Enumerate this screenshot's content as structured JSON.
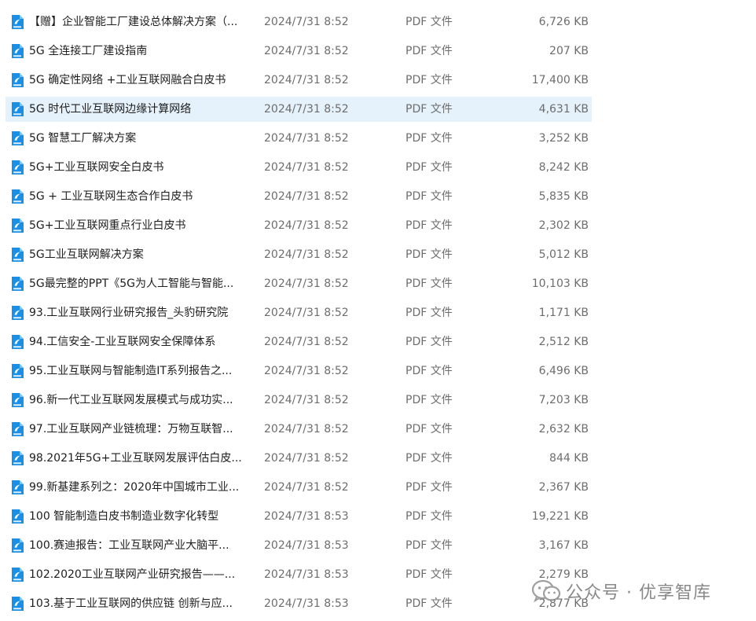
{
  "colors": {
    "selected_row_bg": "#e5f1fb",
    "pdf_icon_blue": "#1a8fe6",
    "name_text": "#1e1e1e",
    "meta_text": "#6d6d6d"
  },
  "icon_name": "pdf-file-icon",
  "files": [
    {
      "name": "【赠】企业智能工厂建设总体解决方案（...",
      "date": "2024/7/31 8:52",
      "type": "PDF 文件",
      "size": "6,726 KB",
      "selected": false
    },
    {
      "name": "5G 全连接工厂建设指南",
      "date": "2024/7/31 8:52",
      "type": "PDF 文件",
      "size": "207 KB",
      "selected": false
    },
    {
      "name": "5G 确定性网络 +工业互联网融合白皮书",
      "date": "2024/7/31 8:52",
      "type": "PDF 文件",
      "size": "17,400 KB",
      "selected": false
    },
    {
      "name": "5G 时代工业互联网边缘计算网络",
      "date": "2024/7/31 8:52",
      "type": "PDF 文件",
      "size": "4,631 KB",
      "selected": true
    },
    {
      "name": "5G 智慧工厂解决方案",
      "date": "2024/7/31 8:52",
      "type": "PDF 文件",
      "size": "3,252 KB",
      "selected": false
    },
    {
      "name": "5G+工业互联网安全白皮书",
      "date": "2024/7/31 8:52",
      "type": "PDF 文件",
      "size": "8,242 KB",
      "selected": false
    },
    {
      "name": "5G + 工业互联网生态合作白皮书",
      "date": "2024/7/31 8:52",
      "type": "PDF 文件",
      "size": "5,835 KB",
      "selected": false
    },
    {
      "name": "5G+工业互联网重点行业白皮书",
      "date": "2024/7/31 8:52",
      "type": "PDF 文件",
      "size": "2,302 KB",
      "selected": false
    },
    {
      "name": "5G工业互联网解决方案",
      "date": "2024/7/31 8:52",
      "type": "PDF 文件",
      "size": "5,012 KB",
      "selected": false
    },
    {
      "name": "5G最完整的PPT《5G为人工智能与智能...",
      "date": "2024/7/31 8:52",
      "type": "PDF 文件",
      "size": "10,103 KB",
      "selected": false
    },
    {
      "name": "93.工业互联网行业研究报告_头豹研究院",
      "date": "2024/7/31 8:52",
      "type": "PDF 文件",
      "size": "1,171 KB",
      "selected": false
    },
    {
      "name": "94.工信安全-工业互联网安全保障体系",
      "date": "2024/7/31 8:52",
      "type": "PDF 文件",
      "size": "2,512 KB",
      "selected": false
    },
    {
      "name": "95.工业互联网与智能制造IT系列报告之...",
      "date": "2024/7/31 8:52",
      "type": "PDF 文件",
      "size": "6,496 KB",
      "selected": false
    },
    {
      "name": "96.新一代工业互联网发展模式与成功实...",
      "date": "2024/7/31 8:52",
      "type": "PDF 文件",
      "size": "7,203 KB",
      "selected": false
    },
    {
      "name": "97.工业互联网产业链梳理：万物互联智...",
      "date": "2024/7/31 8:52",
      "type": "PDF 文件",
      "size": "2,632 KB",
      "selected": false
    },
    {
      "name": "98.2021年5G+工业互联网发展评估白皮...",
      "date": "2024/7/31 8:52",
      "type": "PDF 文件",
      "size": "844 KB",
      "selected": false
    },
    {
      "name": "99.新基建系列之：2020年中国城市工业...",
      "date": "2024/7/31 8:52",
      "type": "PDF 文件",
      "size": "2,367 KB",
      "selected": false
    },
    {
      "name": "100 智能制造白皮书制造业数字化转型",
      "date": "2024/7/31 8:53",
      "type": "PDF 文件",
      "size": "19,221 KB",
      "selected": false
    },
    {
      "name": "100.赛迪报告：工业互联网产业大脑平...",
      "date": "2024/7/31 8:53",
      "type": "PDF 文件",
      "size": "3,167 KB",
      "selected": false
    },
    {
      "name": "102.2020工业互联网产业研究报告——...",
      "date": "2024/7/31 8:53",
      "type": "PDF 文件",
      "size": "2,279 KB",
      "selected": false
    },
    {
      "name": "103.基于工业互联网的供应链 创新与应...",
      "date": "2024/7/31 8:53",
      "type": "PDF 文件",
      "size": "2,877 KB",
      "selected": false
    }
  ],
  "watermark": {
    "text": "公众号 · 优享智库"
  }
}
